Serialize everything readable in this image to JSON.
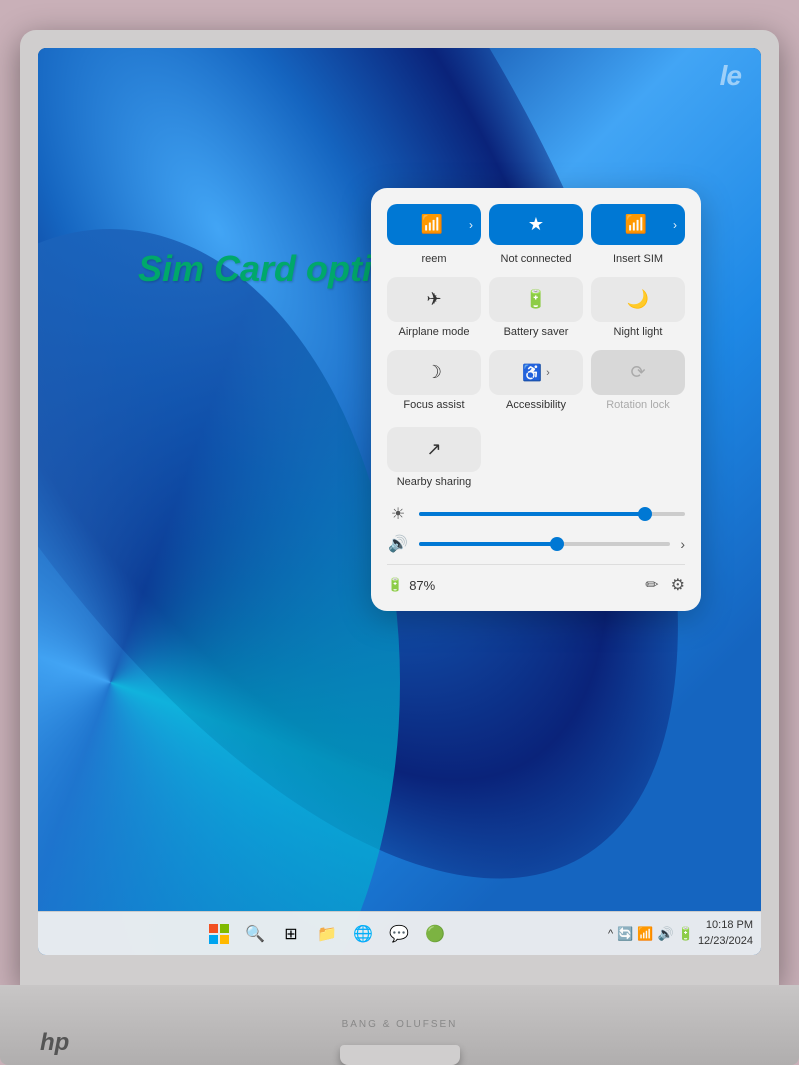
{
  "watermark": "le",
  "simCardOverlay": "Sim Card options",
  "quickSettings": {
    "topButtons": [
      {
        "icon": "📶",
        "hasArrow": true,
        "label": "reem"
      },
      {
        "icon": "🔵",
        "hasArrow": false,
        "label": "Not connected"
      },
      {
        "icon": "📊",
        "hasArrow": true,
        "label": "Insert SIM"
      }
    ],
    "secondRowButtons": [
      {
        "icon": "✈",
        "label": "Airplane mode"
      },
      {
        "icon": "🔋",
        "label": "Battery saver"
      },
      {
        "icon": "🌙",
        "label": "Night light"
      }
    ],
    "thirdRowButtons": [
      {
        "icon": "🌙",
        "label": "Focus assist"
      },
      {
        "icon": "♿",
        "label": "Accessibility",
        "hasArrow": true
      },
      {
        "icon": "🔄",
        "label": "Rotation lock",
        "disabled": true
      }
    ],
    "fourthRowButtons": [
      {
        "icon": "↗",
        "label": "Nearby sharing"
      }
    ],
    "brightnessIcon": "☀",
    "brightnessValue": 85,
    "volumeIcon": "🔊",
    "volumeValue": 55,
    "battery": "87%",
    "batteryIcon": "🔋",
    "editIcon": "✏",
    "settingsIcon": "⚙"
  },
  "taskbar": {
    "centerIcons": [
      "⊞",
      "🔍",
      "📁",
      "🌐",
      "💬",
      "🟢"
    ],
    "sysIcons": [
      "^",
      "🔄",
      "📶",
      "🔊",
      "🔋"
    ],
    "time": "10:18 PM",
    "date": "12/23/2024"
  },
  "bangOlufsen": "BANG & OLUFSEN",
  "hpLogo": "hp"
}
